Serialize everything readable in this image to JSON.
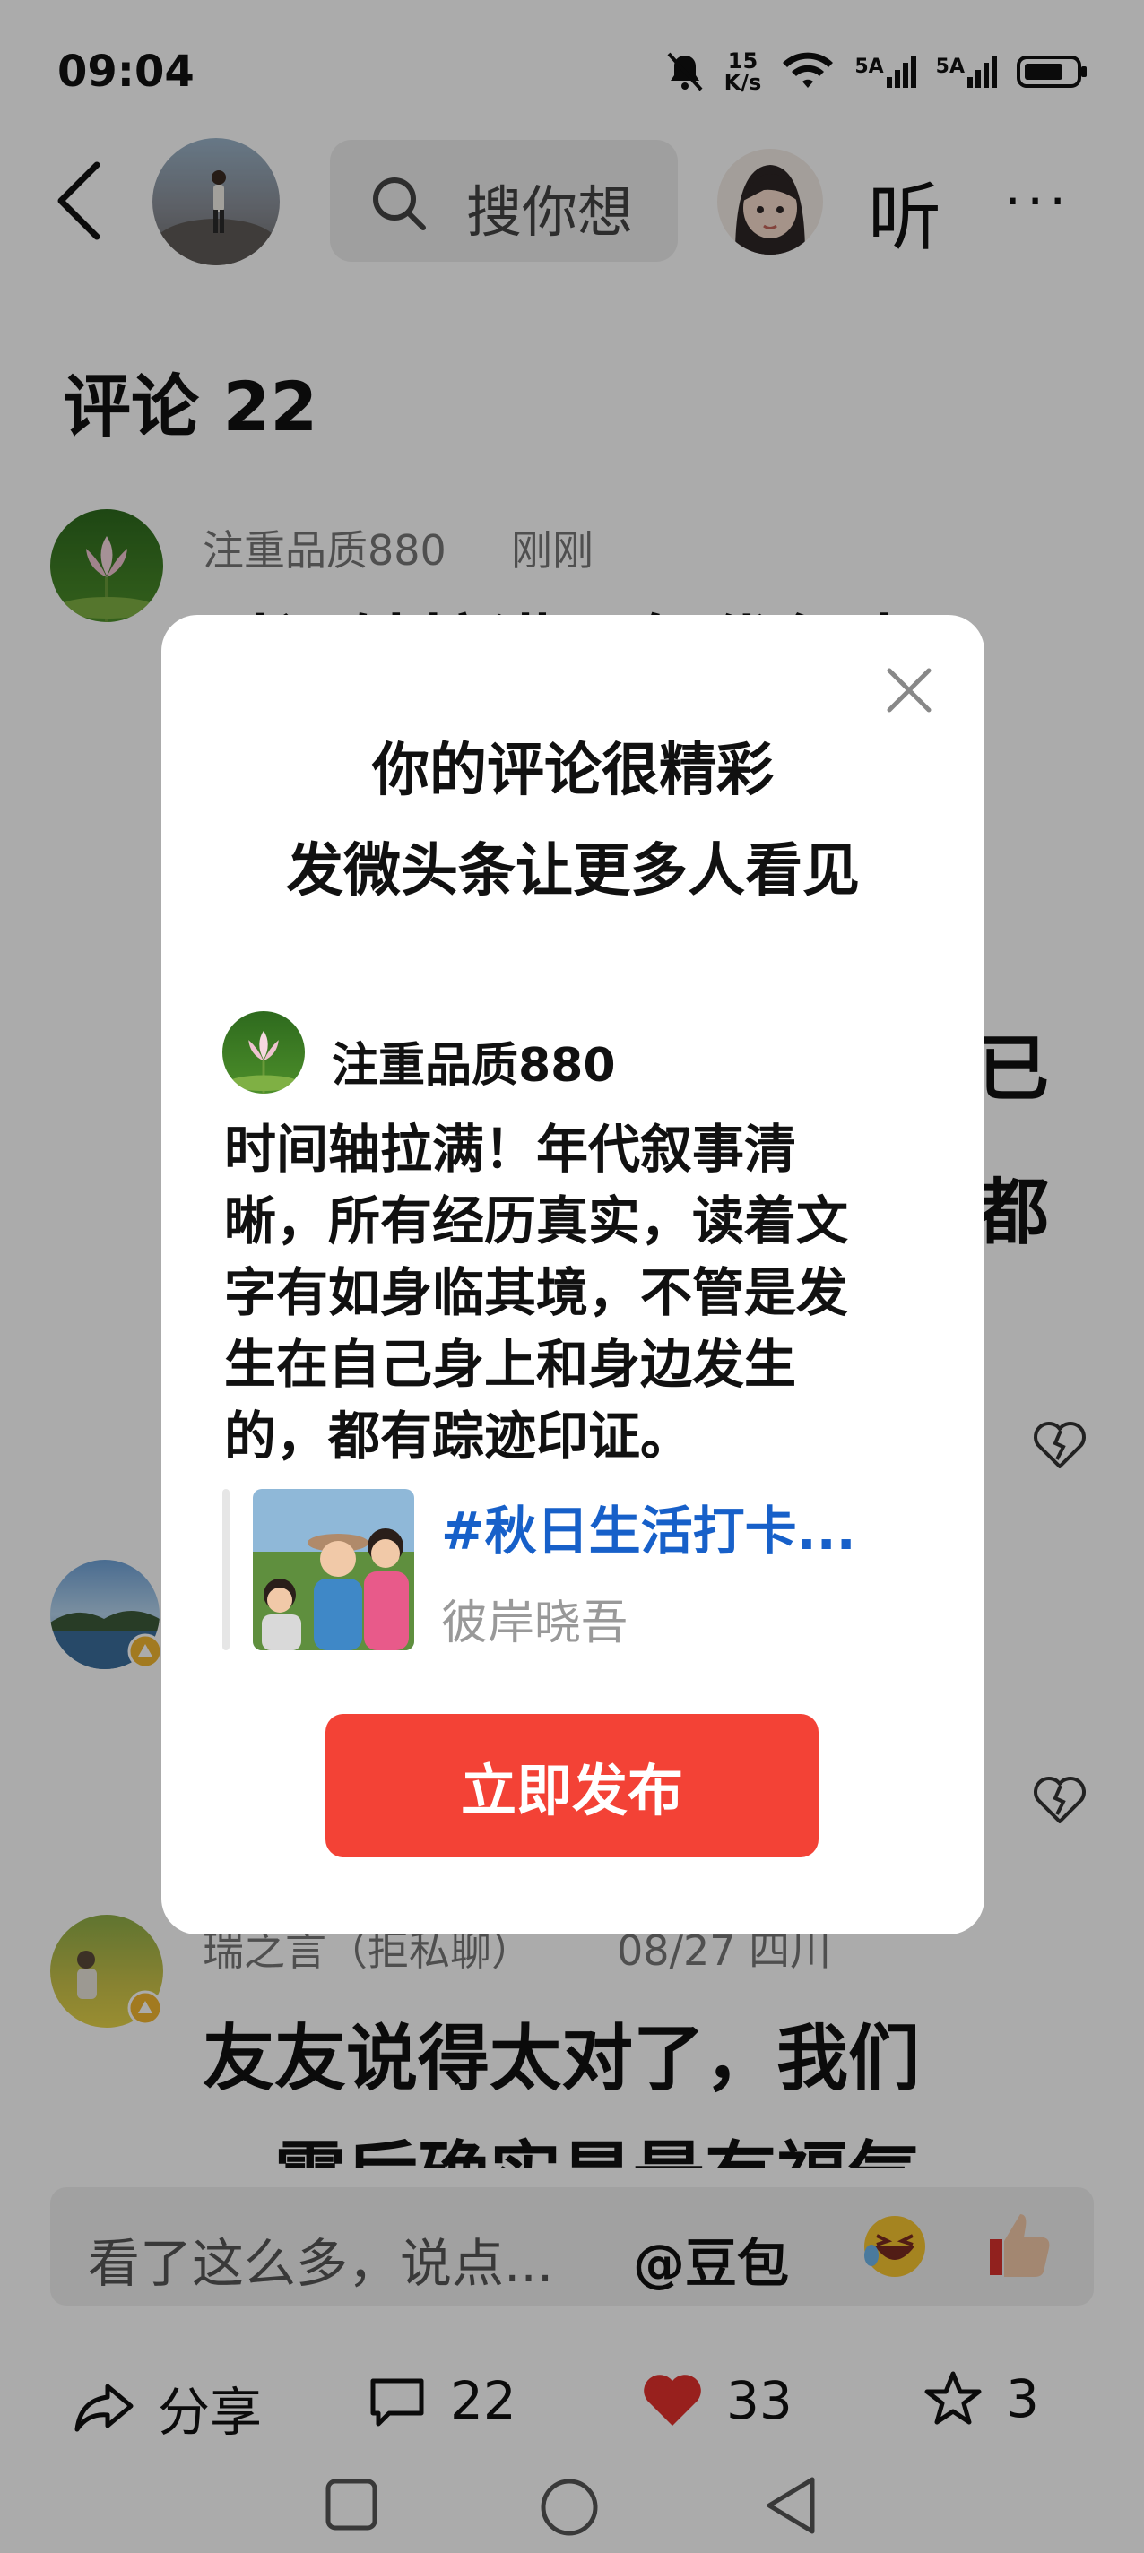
{
  "status_bar": {
    "time": "09:04",
    "net_speed_value": "15",
    "net_speed_unit": "K/s",
    "sim1": "5A",
    "sim2": "5A"
  },
  "header": {
    "search_placeholder": "搜你想",
    "listen_label": "听",
    "more_label": "···"
  },
  "comments": {
    "title": "评论 22",
    "items": [
      {
        "user": "注重品质880",
        "time": "刚刚",
        "text_fragment": "时间轴拉满！年代叙事"
      },
      {
        "user": "瑞之言（拒私聊）",
        "time": "08/27 四川",
        "line1": "友友说得太对了，我们",
        "line2": "一震后确实是最有福气"
      }
    ],
    "right_fragment_1": "已",
    "right_fragment_2": "都"
  },
  "comment_input": {
    "placeholder": "看了这么多，说点...",
    "mention": "@豆包"
  },
  "actions": {
    "share_label": "分享",
    "comment_count": "22",
    "like_count": "33",
    "favorite_count": "3"
  },
  "dialog": {
    "title_line1": "你的评论很精彩",
    "title_line2": "发微头条让更多人看见",
    "username": "注重品质880",
    "comment_lines": [
      "时间轴拉满！年代叙事清",
      "晰，所有经历真实，读着文",
      "字有如身临其境，不管是发",
      "生在自己身上和身边发生",
      "的，都有踪迹印证。"
    ],
    "topic": "#秋日生活打卡...",
    "topic_author": "彼岸晓吾",
    "publish_button": "立即发布"
  },
  "colors": {
    "accent_red": "#f34236",
    "topic_blue": "#1760c9",
    "like_red": "#e3312c"
  }
}
